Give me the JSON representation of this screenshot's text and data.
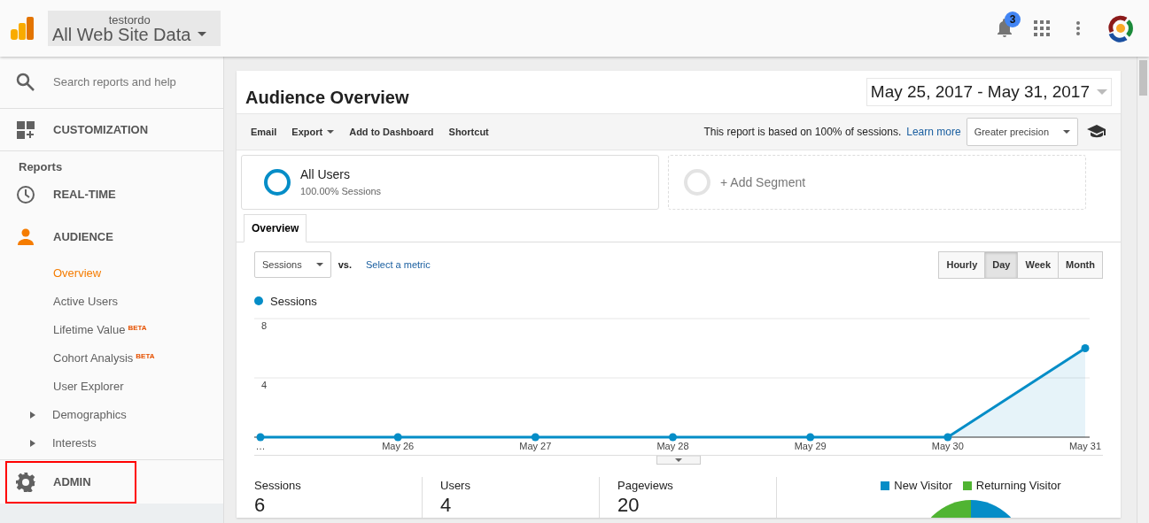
{
  "header": {
    "account": "testordo",
    "property": "All Web Site Data",
    "notification_count": "3"
  },
  "sidebar": {
    "search_placeholder": "Search reports and help",
    "customization": {
      "label": "CUSTOMIZATION"
    },
    "reports_heading": "Reports",
    "realtime": {
      "label": "REAL-TIME",
      "active": false
    },
    "audience": {
      "label": "AUDIENCE",
      "active": true,
      "children": [
        {
          "kind": "page",
          "label": "Overview",
          "selected": true
        },
        {
          "kind": "page",
          "label": "Active Users",
          "selected": false
        },
        {
          "kind": "page",
          "label": "Lifetime Value",
          "badge": "BETA",
          "selected": false
        },
        {
          "kind": "page",
          "label": "Cohort Analysis",
          "badge": "BETA",
          "selected": false
        },
        {
          "kind": "page",
          "label": "User Explorer",
          "selected": false
        },
        {
          "kind": "folder",
          "label": "Demographics",
          "selected": false,
          "expanded": false
        },
        {
          "kind": "folder",
          "label": "Interests",
          "selected": false,
          "expanded": false
        }
      ]
    },
    "admin": {
      "label": "ADMIN",
      "highlighted": true
    }
  },
  "report": {
    "title": "Audience Overview",
    "date_range": "May 25, 2017 - May 31, 2017",
    "actions": [
      {
        "label": "Email",
        "dropdown": false
      },
      {
        "label": "Export",
        "dropdown": true
      },
      {
        "label": "Add to Dashboard",
        "dropdown": false
      },
      {
        "label": "Shortcut",
        "dropdown": false
      }
    ],
    "sampling_note": "This report is based on 100% of sessions.",
    "sampling_link": "Learn more",
    "precision": "Greater precision",
    "segments": [
      {
        "kind": "active",
        "name": "All Users",
        "detail": "100.00% Sessions"
      },
      {
        "kind": "add",
        "name": "+ Add Segment"
      }
    ],
    "tabs": [
      {
        "label": "Overview",
        "selected": true
      }
    ],
    "metric": "Sessions",
    "vs": "vs.",
    "compare_link": "Select a metric",
    "granularity": [
      {
        "label": "Hourly",
        "selected": false
      },
      {
        "label": "Day",
        "selected": true
      },
      {
        "label": "Week",
        "selected": false
      },
      {
        "label": "Month",
        "selected": false
      }
    ],
    "chart_data": {
      "type": "area",
      "categories": [
        "…",
        "May 26",
        "May 27",
        "May 28",
        "May 29",
        "May 30",
        "May 31"
      ],
      "series": [
        {
          "name": "Sessions",
          "color": "#058dc7",
          "values": [
            0,
            0,
            0,
            0,
            0,
            0,
            6
          ]
        }
      ],
      "ylim": [
        0,
        8
      ],
      "yticks": [
        4,
        8
      ]
    },
    "metrics": [
      {
        "label": "Sessions",
        "value": "6"
      },
      {
        "label": "Users",
        "value": "4"
      },
      {
        "label": "Pageviews",
        "value": "20"
      }
    ],
    "pie_legend": [
      {
        "label": "New Visitor",
        "color": "#058dc7"
      },
      {
        "label": "Returning Visitor",
        "color": "#50b432"
      }
    ]
  }
}
